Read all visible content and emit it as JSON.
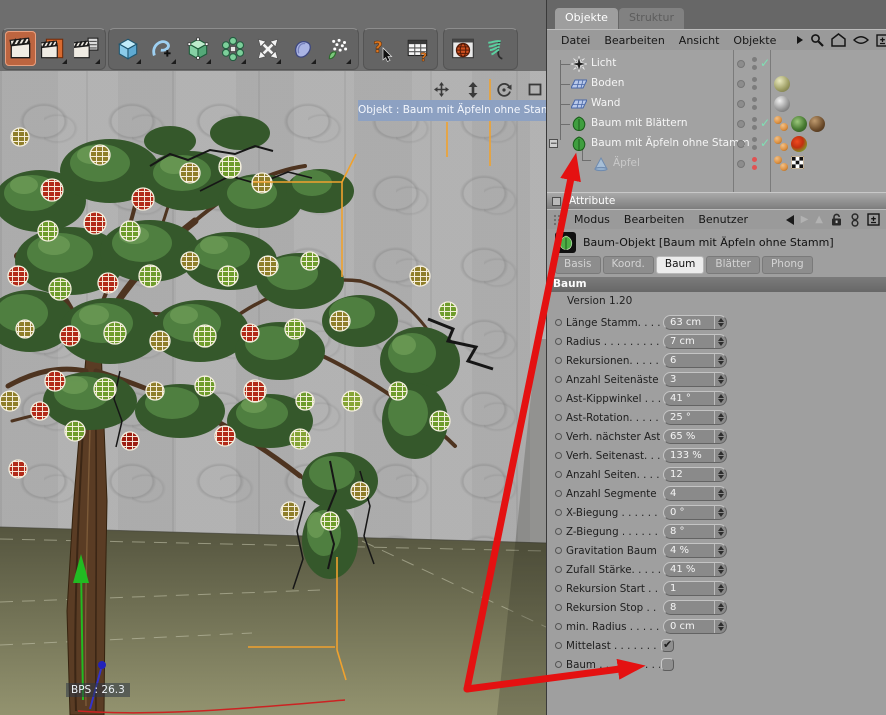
{
  "colors": {
    "selection_orange": "#f0a22e",
    "annotation_red": "#e41111",
    "check_teal": "#7fe0b4",
    "disabled_red": "#e05353"
  },
  "toolbar": {
    "buttons": [
      {
        "name": "render-view",
        "selected": true
      },
      {
        "name": "render-picture-viewer"
      },
      {
        "name": "render-settings"
      },
      {
        "name": "add-primitive-cube"
      },
      {
        "name": "add-spline"
      },
      {
        "name": "add-nurbs"
      },
      {
        "name": "add-modeling-object"
      },
      {
        "name": "add-deformer-arrows"
      },
      {
        "name": "add-bone-deformer"
      },
      {
        "name": "add-particle-emitter"
      },
      {
        "name": "context-help"
      },
      {
        "name": "content-browser"
      },
      {
        "name": "online-globe"
      },
      {
        "name": "hair-module"
      }
    ]
  },
  "viewport": {
    "tooltip": "Objekt : Baum mit Äpfeln ohne Stamm",
    "fps_label": "BPS : 26.3",
    "controls": [
      "pan-icon",
      "zoom-icon",
      "rotate-icon",
      "maximize-icon"
    ]
  },
  "object_manager": {
    "tabs": [
      {
        "label": "Objekte",
        "active": true
      },
      {
        "label": "Struktur",
        "active": false
      }
    ],
    "menu": [
      "Datei",
      "Bearbeiten",
      "Ansicht",
      "Objekte"
    ],
    "toolbar_icons": [
      "overflow-arrow",
      "search-icon",
      "home-icon",
      "eye-icon",
      "add-icon"
    ],
    "objects": [
      {
        "name": "Licht",
        "icon": "light-icon",
        "enabled_check": true,
        "dots": "gray",
        "materials": []
      },
      {
        "name": "Boden",
        "icon": "floor-icon",
        "dots": "gray",
        "materials": [
          "material-sphere-olive"
        ]
      },
      {
        "name": "Wand",
        "icon": "floor-icon",
        "dots": "gray",
        "materials": [
          "material-sphere-gray"
        ]
      },
      {
        "name": "Baum mit Blättern",
        "icon": "leaf-icon",
        "enabled_check": true,
        "dots": "gray",
        "materials": [
          "phong-tag",
          "material-sphere-leaves",
          "material-sphere-bark"
        ]
      },
      {
        "name": "Baum mit Äpfeln ohne Stamm",
        "icon": "leaf-icon",
        "enabled_check": true,
        "expanded": true,
        "dots": "gray",
        "materials": [
          "phong-tag",
          "material-sphere-apple"
        ]
      },
      {
        "name": "Äpfel",
        "icon": "cone-icon",
        "disabled": true,
        "level": 1,
        "dots": "red",
        "materials": [
          "phong-tag",
          "checker-tag"
        ]
      }
    ]
  },
  "attributes": {
    "title": "Attribute",
    "menu": [
      "Modus",
      "Bearbeiten",
      "Benutzer"
    ],
    "header_icons": [
      "back-arrow-icon",
      "forward-arrow-icon",
      "up-arrow-icon",
      "lock-icon",
      "history-icon",
      "add-icon"
    ],
    "object_title": "Baum-Objekt [Baum mit Äpfeln ohne Stamm]",
    "tabs": [
      {
        "label": "Basis"
      },
      {
        "label": "Koord."
      },
      {
        "label": "Baum",
        "active": true
      },
      {
        "label": "Blätter"
      },
      {
        "label": "Phong"
      }
    ],
    "section": "Baum",
    "version": "Version 1.20",
    "params": [
      {
        "label": "Länge Stamm. . . .",
        "value": "63 cm",
        "control": "spinner"
      },
      {
        "label": "Radius . . . . . . . . .",
        "value": "7 cm",
        "control": "spinner"
      },
      {
        "label": "Rekursionen. . . . .",
        "value": "6",
        "control": "spinner"
      },
      {
        "label": "Anzahl Seitenäste",
        "value": "3",
        "control": "spinner"
      },
      {
        "label": "Ast-Kippwinkel . . .",
        "value": "41 °",
        "control": "spinner"
      },
      {
        "label": "Ast-Rotation. . . . .",
        "value": "25 °",
        "control": "spinner"
      },
      {
        "label": "Verh. nächster Ast",
        "value": "65 %",
        "control": "spinner"
      },
      {
        "label": "Verh. Seitenast. . .",
        "value": "133 %",
        "control": "spinner"
      },
      {
        "label": "Anzahl Seiten. . . .",
        "value": "12",
        "control": "spinner"
      },
      {
        "label": "Anzahl Segmente",
        "value": "4",
        "control": "spinner"
      },
      {
        "label": "X-Biegung . . . . . .",
        "value": "0 °",
        "control": "spinner"
      },
      {
        "label": "Z-Biegung . . . . . .",
        "value": "8 °",
        "control": "spinner"
      },
      {
        "label": "Gravitation Baum",
        "value": "4 %",
        "control": "spinner"
      },
      {
        "label": "Zufall Stärke. . . . .",
        "value": "41 %",
        "control": "spinner"
      },
      {
        "label": "Rekursion Start . .",
        "value": "1",
        "control": "spinner"
      },
      {
        "label": "Rekursion Stop . .",
        "value": "8",
        "control": "spinner"
      },
      {
        "label": "min. Radius . . . . .",
        "value": "0 cm",
        "control": "spinner"
      },
      {
        "label": "Mittelast . . . . . . . .",
        "control": "checkbox",
        "checked": true
      },
      {
        "label": "Baum . . . . . . . . . .",
        "control": "checkbox",
        "checked": false
      }
    ]
  },
  "annotations": {
    "color": "#e41111",
    "arrows": [
      {
        "points_to": "object-row-aepfel"
      },
      {
        "points_to": "param-baum-checkbox"
      }
    ]
  }
}
